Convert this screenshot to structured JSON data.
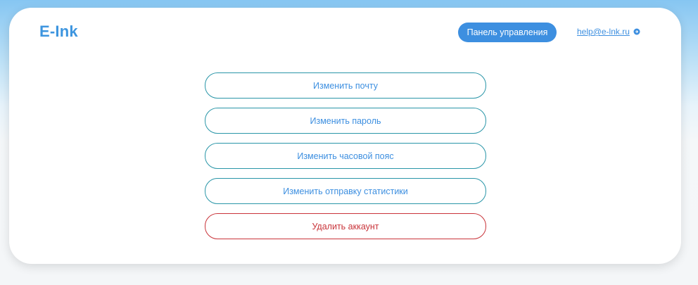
{
  "header": {
    "logo": "E-Ink",
    "panel_button": "Панель управления",
    "help_email": "help@e-lnk.ru",
    "help_icon": "arrow-circle-icon"
  },
  "actions": [
    {
      "label": "Изменить почту"
    },
    {
      "label": "Изменить пароль"
    },
    {
      "label": "Изменить часовой пояс"
    },
    {
      "label": "Изменить отправку статистики"
    },
    {
      "label": "Удалить аккаунт"
    }
  ],
  "colors": {
    "accent": "#3d8fe0",
    "border": "#2a96a8",
    "danger": "#c9343a"
  }
}
